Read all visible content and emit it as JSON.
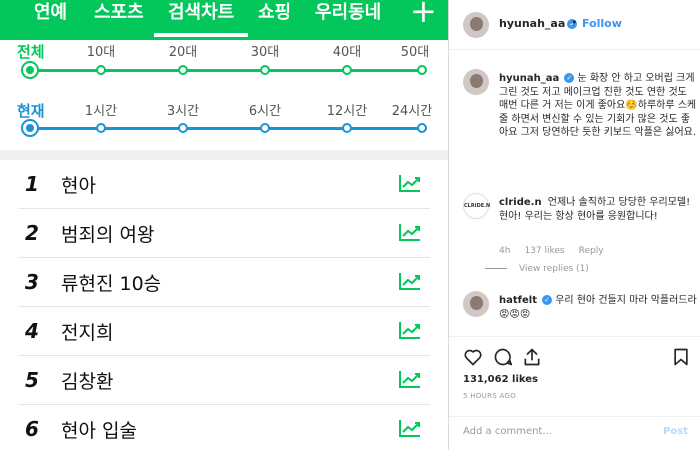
{
  "naver": {
    "nav": [
      "연예",
      "스포츠",
      "검색차트",
      "쇼핑",
      "우리동네"
    ],
    "plus": "+",
    "age_filter": {
      "label": "전체",
      "ticks": [
        "10대",
        "20대",
        "30대",
        "40대",
        "50대"
      ]
    },
    "time_filter": {
      "label": "현재",
      "ticks": [
        "1시간",
        "3시간",
        "6시간",
        "12시간",
        "24시간"
      ]
    },
    "ranks": [
      {
        "num": "1",
        "keyword": "현아"
      },
      {
        "num": "2",
        "keyword": "범죄의 여왕"
      },
      {
        "num": "3",
        "keyword": "류현진 10승"
      },
      {
        "num": "4",
        "keyword": "전지희"
      },
      {
        "num": "5",
        "keyword": "김창환"
      },
      {
        "num": "6",
        "keyword": "현아 입술"
      }
    ],
    "colors": {
      "green": "#03c75a",
      "blue": "#1a93d6"
    }
  },
  "instagram": {
    "header": {
      "username": "hyunah_aa",
      "dot": "•",
      "follow": "Follow"
    },
    "comments": [
      {
        "user": "hyunah_aa",
        "text": "눈 화장 안 하고 오버립 크게 그린 것도 저고 메이크업 진한 것도 연한 것도 매번 다른 거 저는 이게 좋아요☺️하루하루 스케줄 하면서 변신할 수 있는 기회가 많은 것도 좋아요 그저 당연하단 듯한 키보드 악플은 싫어요."
      },
      {
        "user": "clride.n",
        "avatar_text": "CLRIDE.N",
        "text": "언제나 솔직하고 당당한 우리모델! 현아! 우리는 항상 현아를 응원합니다!",
        "time": "4h",
        "likes": "137 likes",
        "reply": "Reply",
        "view_replies": "View replies (1)"
      },
      {
        "user": "hatfelt",
        "text": "우리 현아 건들지 마라 악플러드라 😡😡😡"
      }
    ],
    "likes": "131,062 likes",
    "when": "5 HOURS AGO",
    "add_comment_placeholder": "Add a comment…",
    "post_label": "Post"
  }
}
